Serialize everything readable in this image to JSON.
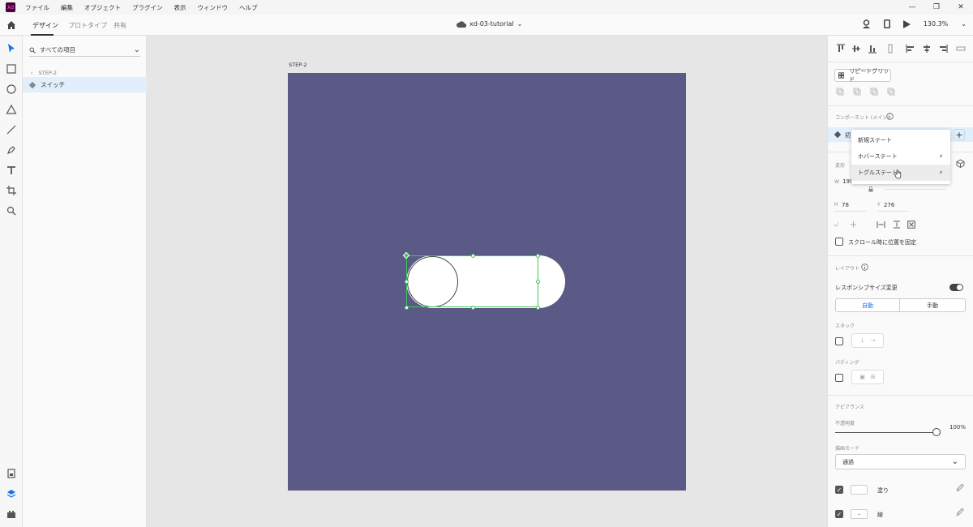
{
  "menubar": {
    "logo": "Xd",
    "items": [
      "ファイル",
      "編集",
      "オブジェクト",
      "プラグイン",
      "表示",
      "ウィンドウ",
      "ヘルプ"
    ]
  },
  "toolbar": {
    "tabs": [
      "デザイン",
      "プロトタイプ",
      "共有"
    ],
    "doc_title": "xd-03-tutorial",
    "zoom": "130.3%"
  },
  "layers": {
    "search_placeholder": "すべての項目",
    "breadcrumb": "STEP-2",
    "items": [
      "スイッチ"
    ]
  },
  "canvas": {
    "artboard_label": "STEP-2",
    "colors": {
      "artboard": "#5b5a87",
      "selection": "#3fc35c"
    }
  },
  "props": {
    "repeat_grid": "リピートグリッド",
    "component_header": "コンポーネント (メイン)",
    "component_name_fragment": "初",
    "transform_label": "変形",
    "w_label": "W",
    "w_value": "199",
    "h_label": "H",
    "h_value": "78",
    "y_label": "Y",
    "y_value": "276",
    "fix_scroll": "スクロール時に位置を固定",
    "layout_header": "レイアウト",
    "responsive": "レスポンシブサイズ変更",
    "auto": "自動",
    "manual": "手動",
    "stack": "スタック",
    "padding": "パディング",
    "appearance": "アピアランス",
    "opacity_label": "不透明度",
    "opacity_value": "100%",
    "opacity_fraction": 1.0,
    "blend_label": "描画モード",
    "blend_value": "通過",
    "fill_label": "塗り",
    "stroke_label": "線"
  },
  "popup": {
    "items": [
      {
        "label": "新規ステート",
        "bolt": ""
      },
      {
        "label": "ホバーステート",
        "bolt": "⚡"
      },
      {
        "label": "トグルステート",
        "bolt": "⚡"
      }
    ]
  }
}
